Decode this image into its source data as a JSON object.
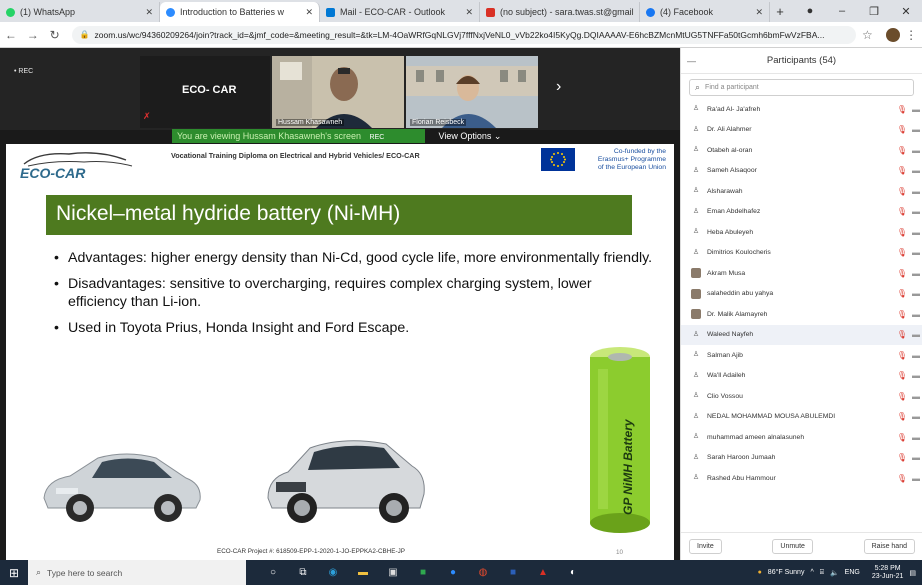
{
  "browser": {
    "tabs": [
      {
        "label": "(1) WhatsApp",
        "color": "#25d366"
      },
      {
        "label": "Introduction to Batteries w",
        "color": "#2d8cff"
      },
      {
        "label": "Mail - ECO-CAR - Outlook",
        "color": "#0078d4"
      },
      {
        "label": "(no subject) - sara.twas.st@gmail",
        "color": "#d93025"
      },
      {
        "label": "(4) Facebook",
        "color": "#1877f2"
      }
    ],
    "url": "zoom.us/wc/94360209264/join?track_id=&jmf_code=&meeting_result=&tk=LM-4OaWRfGqNLGVj7fffNxjVeNL0_vVb22ko4I5KyQg.DQIAAAAV-E6hcBZMcnMtUG5TNFFa50tGcmh6bmFwVzFBA...",
    "icons": {
      "back": "back-arrow-icon",
      "forward": "forward-arrow-icon",
      "reload": "reload-icon",
      "lock": "lock-icon",
      "star": "star-icon"
    }
  },
  "meeting": {
    "rec_label": "• REC",
    "tiles": [
      {
        "name": "ECO- CAR"
      },
      {
        "name": "Hussam Khasawneh"
      },
      {
        "name": "Florian Reisbeck"
      }
    ],
    "banner": "You are viewing Hussam Khasawneh's screen",
    "banner_rec": "REC",
    "view_options": "View Options ⌄"
  },
  "slide": {
    "header": "Vocational Training Diploma on Electrical and Hybrid Vehicles/ ECO-CAR",
    "cofund": [
      "Co-funded by the",
      "Erasmus+ Programme",
      "of the European Union"
    ],
    "logo_text": "ECO-CAR",
    "title": "Nickel–metal hydride battery (Ni-MH)",
    "bullets": [
      "Advantages: higher energy density than Ni-Cd, good cycle life, more environmentally friendly.",
      "Disadvantages: sensitive to overcharging, requires complex charging system, lower efficiency than Li-ion.",
      "Used in Toyota Prius, Honda Insight and Ford Escape."
    ],
    "battery_label": "GP NiMH Battery",
    "project": "ECO-CAR Project #: 618509-EPP-1-2020-1-JO-EPPKA2-CBHE-JP",
    "page": "10"
  },
  "participants": {
    "header": "Participants (54)",
    "search_placeholder": "Find a participant",
    "list": [
      {
        "name": "Ra'ad Al- Ja'afreh",
        "avatar": "default"
      },
      {
        "name": "Dr. Ali Alahmer",
        "avatar": "default"
      },
      {
        "name": "Otabeh al-oran",
        "avatar": "default"
      },
      {
        "name": "Sameh Alsaqoor",
        "avatar": "default"
      },
      {
        "name": "Alsharawah",
        "avatar": "default"
      },
      {
        "name": "Eman Abdelhafez",
        "avatar": "default"
      },
      {
        "name": "Heba Abuleyeh",
        "avatar": "default"
      },
      {
        "name": "Dimitrios Koulocheris",
        "avatar": "default"
      },
      {
        "name": "Akram Musa",
        "avatar": "photo"
      },
      {
        "name": "salaheddin abu yahya",
        "avatar": "photo"
      },
      {
        "name": "Dr. Malik Alamayreh",
        "avatar": "photo"
      },
      {
        "name": "Waleed Nayfeh",
        "avatar": "default",
        "highlight": true
      },
      {
        "name": "Salman Ajib",
        "avatar": "default"
      },
      {
        "name": "Wa'll Adaileh",
        "avatar": "default"
      },
      {
        "name": "Clio Vossou",
        "avatar": "default"
      },
      {
        "name": "NEDAL MOHAMMAD MOUSA ABULEMDI",
        "avatar": "default"
      },
      {
        "name": "muhammad ameen alnalasuneh",
        "avatar": "default"
      },
      {
        "name": "Sarah Haroon Jumaah",
        "avatar": "default"
      },
      {
        "name": "Rashed Abu Hammour",
        "avatar": "default"
      }
    ],
    "buttons": {
      "invite": "Invite",
      "unmute": "Unmute",
      "raise": "Raise hand"
    }
  },
  "taskbar": {
    "search": "Type here to search",
    "weather": "86°F Sunny",
    "lang": "ENG",
    "time": "5:28 PM",
    "date": "23-Jun-21"
  }
}
